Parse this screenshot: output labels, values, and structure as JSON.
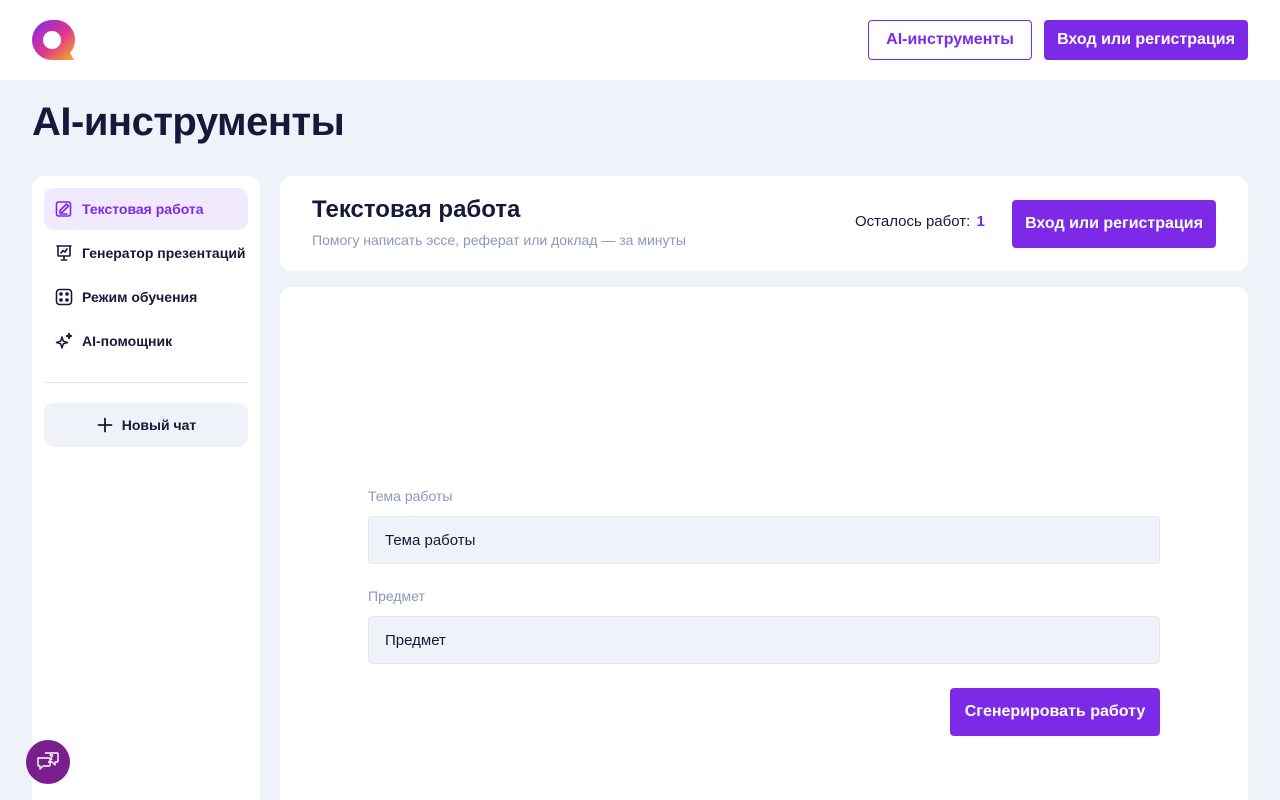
{
  "header": {
    "logo_icon": "ai-logo-icon",
    "tools_button_label": "AI-инструменты",
    "login_button_label": "Вход или регистрация"
  },
  "page": {
    "title": "AI-инструменты"
  },
  "sidebar": {
    "items": [
      {
        "label": "Текстовая работа",
        "icon": "edit-document-icon",
        "active": true
      },
      {
        "label": "Генератор презентаций",
        "icon": "presentation-icon",
        "active": false
      },
      {
        "label": "Режим обучения",
        "icon": "dice-icon",
        "active": false
      },
      {
        "label": "AI-помощник",
        "icon": "sparkles-icon",
        "active": false
      }
    ],
    "new_chat_label": "Новый чат"
  },
  "info_card": {
    "title": "Текстовая работа",
    "subtitle": "Помогу написать эссе, реферат или доклад — за минуты",
    "remaining_label": "Осталось работ:",
    "remaining_count": "1",
    "login_button_label": "Вход или регистрация"
  },
  "form": {
    "topic_label": "Тема работы",
    "topic_placeholder": "Тема работы",
    "subject_label": "Предмет",
    "subject_placeholder": "Предмет",
    "generate_button_label": "Сгенерировать работу"
  },
  "help": {
    "icon": "help-chat-icon"
  },
  "colors": {
    "accent": "#7c2ae8",
    "background": "#eff2f8",
    "text": "#16193a",
    "muted": "#8b98b8",
    "help_button": "#7a1e8e"
  }
}
